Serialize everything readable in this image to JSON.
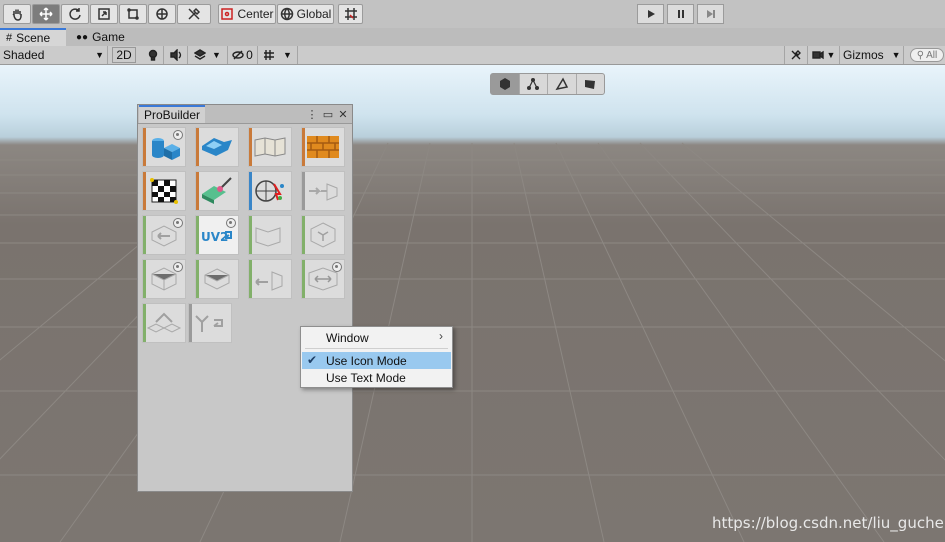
{
  "toolbar": {
    "pivot_label": "Center",
    "space_label": "Global"
  },
  "tabs": [
    {
      "label": "Scene",
      "icon": "hash-icon"
    },
    {
      "label": "Game",
      "icon": "gamepad-icon"
    }
  ],
  "scene_bar": {
    "draw_mode": "Shaded",
    "mode_2d": "2D",
    "hidden_count": "0",
    "gizmos_label": "Gizmos",
    "search_placeholder": "All"
  },
  "probuilder": {
    "title": "ProBuilder"
  },
  "context_menu": {
    "items": [
      {
        "label": "Window",
        "submenu": true
      },
      {
        "label": "Use Icon Mode",
        "checked": true
      },
      {
        "label": "Use Text Mode",
        "checked": false
      }
    ]
  },
  "watermark": "https://blog.csdn.net/liu_gucheng",
  "colors": {
    "accent_tab": "#3a79d8",
    "highlight": "#99c9ef",
    "edge_orange": "#c97a3a",
    "edge_green": "#82b06a",
    "edge_blue": "#3a86c8",
    "edge_gray": "#9a9a9a"
  }
}
